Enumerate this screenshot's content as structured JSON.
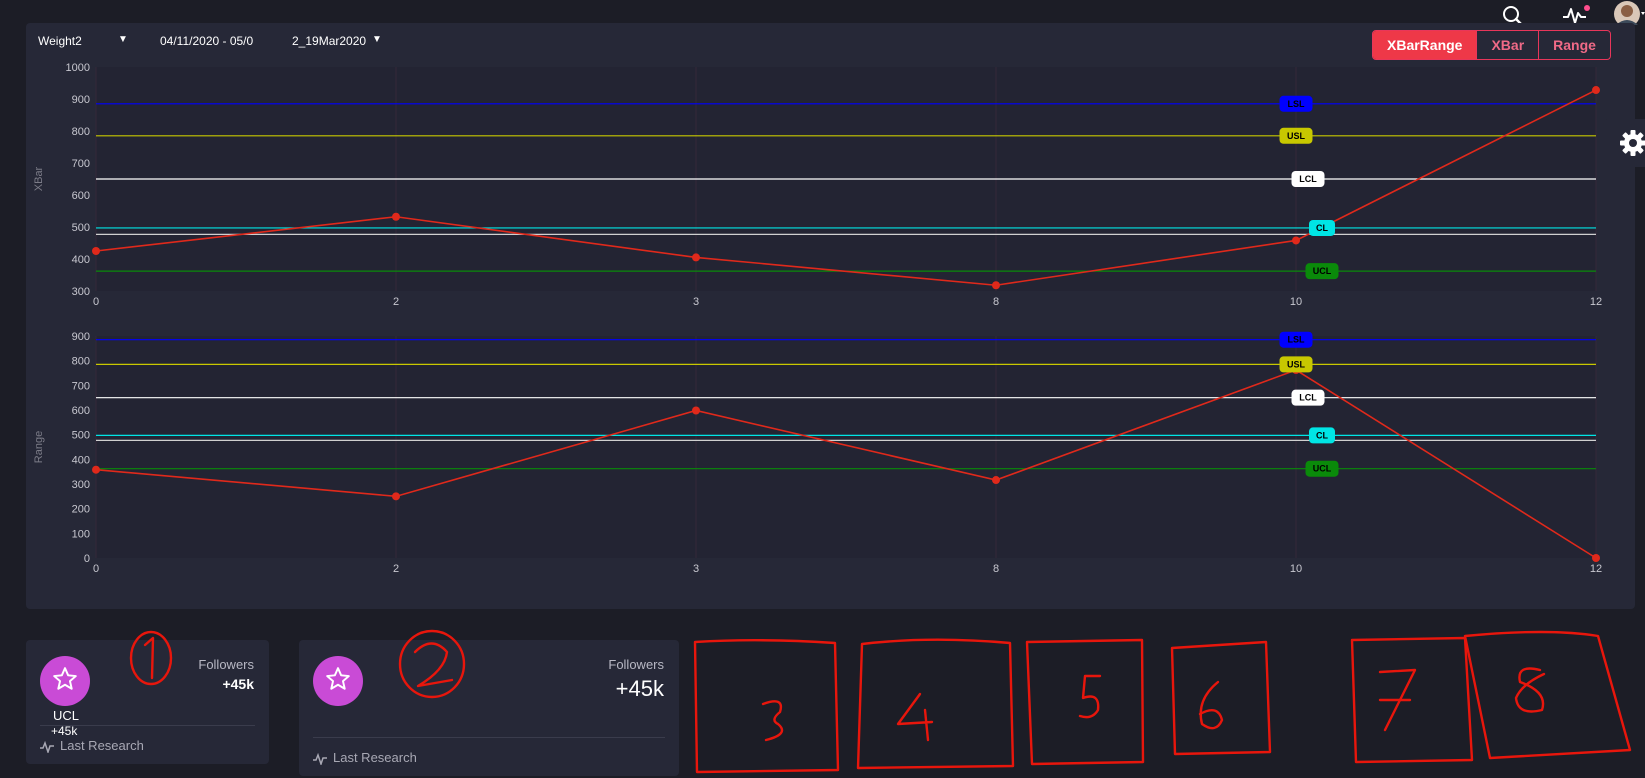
{
  "filters": {
    "metric": "Weight2",
    "date_range": "04/11/2020 - 05/0",
    "batch": "2_19Mar2020"
  },
  "view_tabs": [
    "XBarRange",
    "XBar",
    "Range"
  ],
  "active_tab": "XBarRange",
  "chart_data": [
    {
      "type": "line",
      "ylabel": "XBar",
      "x_categories": [
        "0",
        "2",
        "3",
        "8",
        "10",
        "12"
      ],
      "ylim": [
        300,
        1000
      ],
      "yticks": [
        300,
        400,
        500,
        600,
        700,
        800,
        900,
        1000
      ],
      "series": [
        {
          "values": [
            425,
            532,
            405,
            318,
            458,
            928
          ],
          "color": "#e0291b"
        }
      ],
      "limit_lines": [
        {
          "label": "LSL",
          "value": 885,
          "color": "#0000ff",
          "text_color": "#000000"
        },
        {
          "label": "USL",
          "value": 785,
          "color": "#c8c800",
          "text_color": "#000000"
        },
        {
          "label": "LCL",
          "value": 650,
          "color": "#ffffff",
          "text_color": "#000000"
        },
        {
          "label": "CL",
          "value": 497,
          "color": "#00e5e5",
          "text_color": "#000000"
        },
        {
          "label": "",
          "value": 477,
          "color": "#d0d0d0",
          "text_color": "#000000"
        },
        {
          "label": "UCL",
          "value": 362,
          "color": "#0a8a0a",
          "text_color": "#000000"
        }
      ]
    },
    {
      "type": "line",
      "ylabel": "Range",
      "x_categories": [
        "0",
        "2",
        "3",
        "8",
        "10",
        "12"
      ],
      "ylim": [
        0,
        900
      ],
      "yticks": [
        0,
        100,
        200,
        300,
        400,
        500,
        600,
        700,
        800,
        900
      ],
      "series": [
        {
          "values": [
            358,
            250,
            598,
            316,
            762,
            0
          ],
          "color": "#e0291b"
        }
      ],
      "limit_lines": [
        {
          "label": "LSL",
          "value": 885,
          "color": "#0000ff",
          "text_color": "#000000"
        },
        {
          "label": "USL",
          "value": 785,
          "color": "#c8c800",
          "text_color": "#000000"
        },
        {
          "label": "LCL",
          "value": 650,
          "color": "#ffffff",
          "text_color": "#000000"
        },
        {
          "label": "CL",
          "value": 497,
          "color": "#00e5e5",
          "text_color": "#000000"
        },
        {
          "label": "",
          "value": 477,
          "color": "#d0d0d0",
          "text_color": "#000000"
        },
        {
          "label": "UCL",
          "value": 362,
          "color": "#0a8a0a",
          "text_color": "#000000"
        }
      ]
    }
  ],
  "cards": [
    {
      "title": "Followers",
      "value": "+45k",
      "sub_label": "UCL",
      "sub_value": "+45k",
      "footer": "Last Research",
      "annotation": "1"
    },
    {
      "title": "Followers",
      "value": "+45k",
      "footer": "Last Research",
      "annotation": "2"
    }
  ],
  "annotations": [
    "3",
    "4",
    "5",
    "6",
    "7",
    "8"
  ],
  "colors": {
    "accent": "#ee3848",
    "star_bg": "#c94bd6",
    "panel_bg": "#262837",
    "page_bg": "#1c1d26",
    "annotation": "#e8160c"
  },
  "icons": [
    "search-icon",
    "activity-icon",
    "user-avatar",
    "gear-icon",
    "star-icon",
    "pulse-icon"
  ]
}
